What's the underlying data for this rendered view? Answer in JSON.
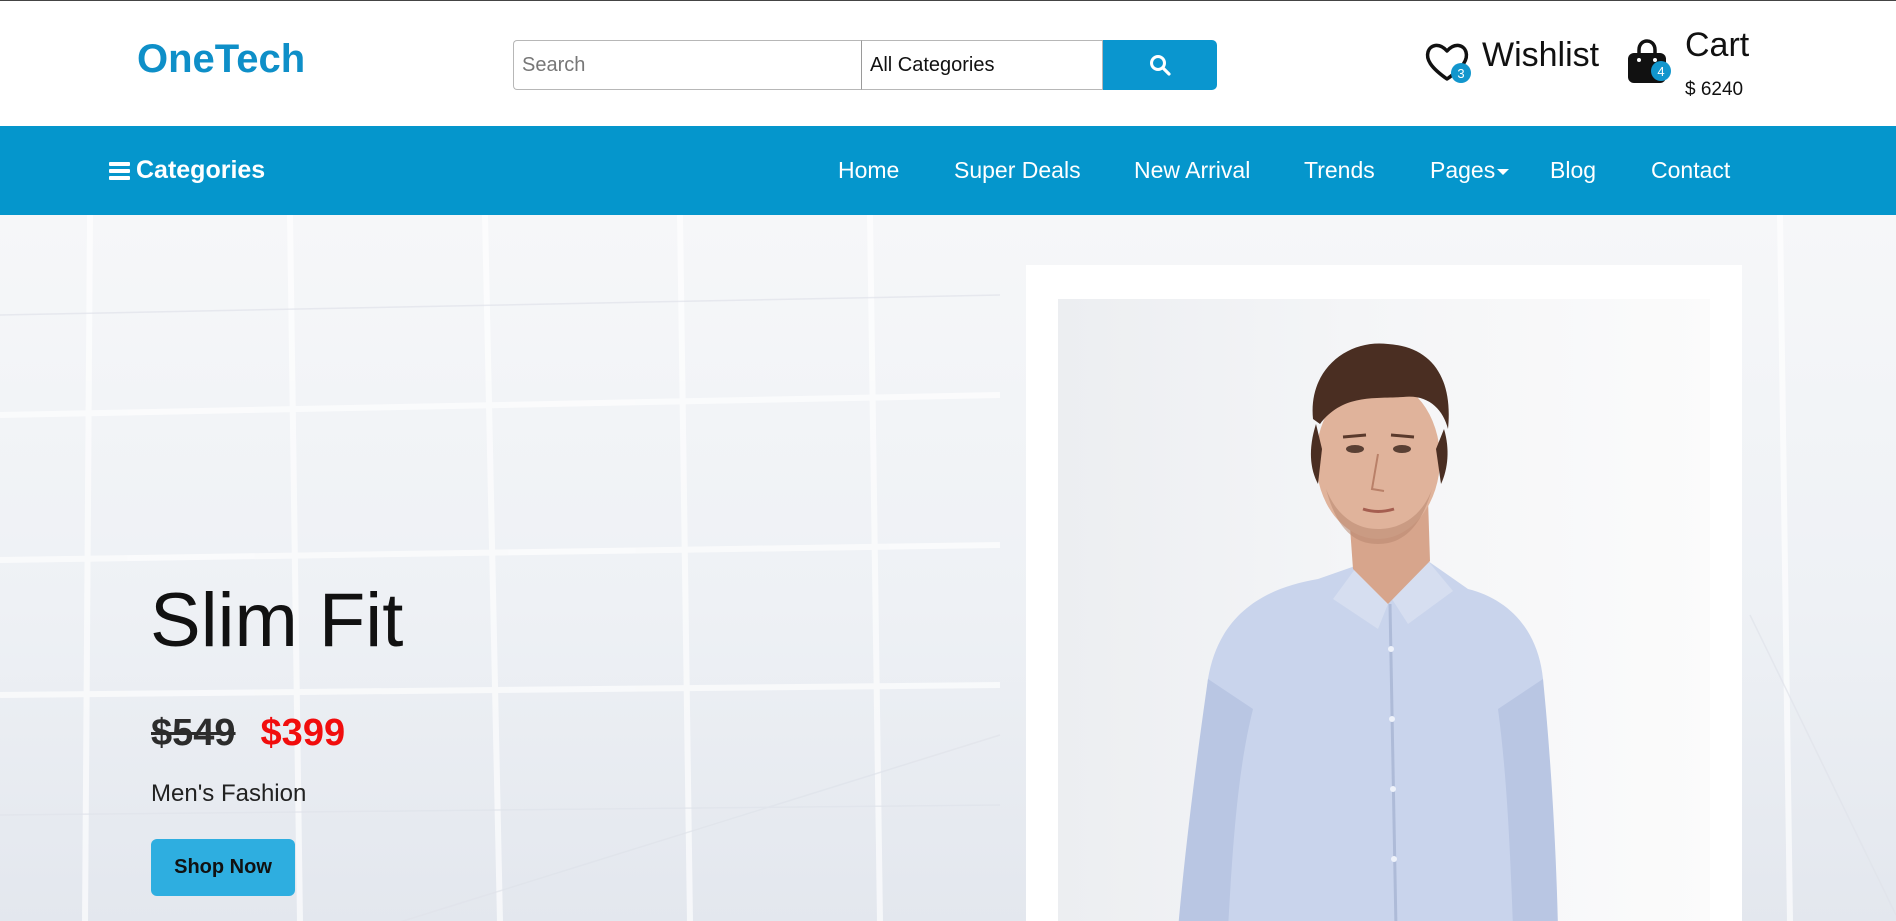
{
  "header": {
    "logo": "OneTech",
    "search": {
      "placeholder": "Search",
      "category_selected": "All Categories"
    },
    "wishlist": {
      "label": "Wishlist",
      "count": "3"
    },
    "cart": {
      "label": "Cart",
      "count": "4",
      "total": "$ 6240"
    }
  },
  "nav": {
    "categories_label": "Categories",
    "links": [
      "Home",
      "Super Deals",
      "New Arrival",
      "Trends",
      "Pages",
      "Blog",
      "Contact"
    ]
  },
  "hero": {
    "title": "Slim Fit",
    "old_price": "$549",
    "new_price": "$399",
    "subtitle": "Men's Fashion",
    "button_label": "Shop Now"
  },
  "colors": {
    "brand": "#0596cc",
    "logo": "#0e8fc8",
    "button": "#2eaee0",
    "sale_price": "#f10d0d"
  },
  "icons": [
    "search-icon",
    "heart-icon",
    "shopping-bag-icon",
    "hamburger-icon",
    "caret-down-icon"
  ]
}
